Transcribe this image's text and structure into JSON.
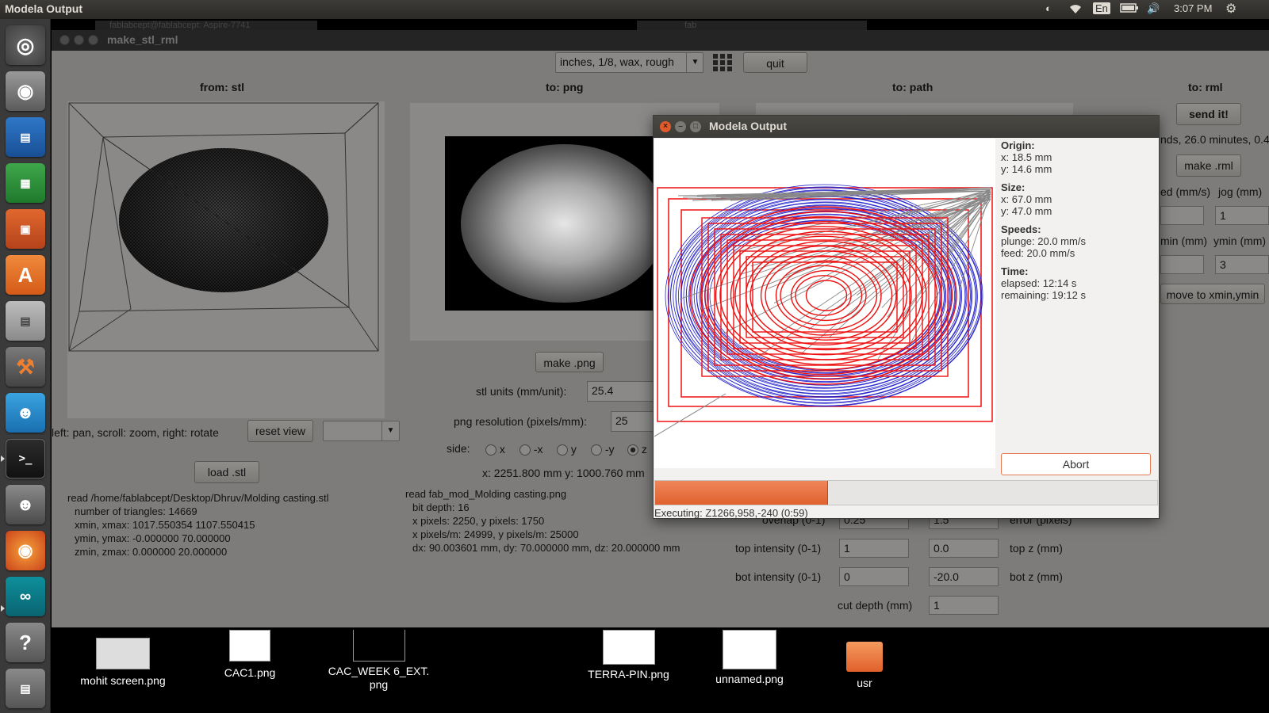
{
  "topbar": {
    "app_title": "Modela Output",
    "keyboard": "En",
    "clock": "3:07 PM"
  },
  "background_windows": {
    "tab1": "fablabcept@fablabcept: Aspire-7741",
    "tab2": "fab"
  },
  "main_window": {
    "title": "make_stl_rml",
    "preset": "inches, 1/8, wax, rough",
    "quit": "quit",
    "col_from_stl": "from: stl",
    "col_to_png": "to: png",
    "col_to_path": "to: path",
    "col_to_rml": "to: rml",
    "hint": "left: pan, scroll: zoom, right: rotate",
    "reset_view": "reset view",
    "view_select": "",
    "load_stl": "load .stl",
    "stl_info": [
      "read /home/fablabcept/Desktop/Dhruv/Molding casting.stl",
      "number of triangles: 14669",
      "xmin, xmax: 1017.550354 1107.550415",
      "ymin, ymax: -0.000000 70.000000",
      "zmin, zmax: 0.000000 20.000000"
    ],
    "make_png": "make .png",
    "stl_units_label": "stl units (mm/unit):",
    "stl_units_value": "25.4",
    "png_res_label": "png resolution (pixels/mm):",
    "png_res_value": "25",
    "side_label": "side:",
    "side_options": [
      "x",
      "-x",
      "y",
      "-y",
      "z"
    ],
    "side_selected": "z",
    "xy_readout": "x: 2251.800 mm  y: 1000.760 mm",
    "png_info": [
      "read fab_mod_Molding casting.png",
      "bit depth: 16",
      "x pixels: 2250, y pixels: 1750",
      "x pixels/m: 24999, y pixels/m: 25000",
      "dx: 90.003601 mm, dy: 70.000000 mm, dz: 20.000000 mm"
    ],
    "overlap_label": "overlap (0-1)",
    "overlap_value": "0.25",
    "error_value": "1.5",
    "error_label": "error (pixels)",
    "top_intensity_label": "top intensity (0-1)",
    "top_intensity_value": "1",
    "top_z_value": "0.0",
    "top_z_label": "top z (mm)",
    "bot_intensity_label": "bot intensity (0-1)",
    "bot_intensity_value": "0",
    "bot_z_value": "-20.0",
    "bot_z_label": "bot z (mm)",
    "cut_depth_label": "cut depth (mm)",
    "cut_depth_value": "1",
    "send_it": "send it!",
    "rml_status": "nds, 26.0 minutes, 0.4",
    "make_rml": "make .rml",
    "speed_label": "ed (mm/s)",
    "jog_label": "jog (mm)",
    "jog_value": "1",
    "xmin_label": "min (mm)",
    "ymin_label": "ymin (mm)",
    "ymin_value": "3",
    "move_to": "move to xmin,ymin"
  },
  "dialog": {
    "title": "Modela Output",
    "origin_h": "Origin:",
    "origin_x": "x: 18.5 mm",
    "origin_y": "y: 14.6 mm",
    "size_h": "Size:",
    "size_x": "x: 67.0 mm",
    "size_y": "y: 47.0 mm",
    "speeds_h": "Speeds:",
    "plunge": "plunge: 20.0 mm/s",
    "feed": "feed: 20.0 mm/s",
    "time_h": "Time:",
    "elapsed": "elapsed: 12:14 s",
    "remaining": "remaining: 19:12 s",
    "abort": "Abort",
    "progress_fraction": 0.345,
    "status": "Executing: Z1266,958,-240 (0:59)"
  },
  "desktop_icons": [
    {
      "label": "mohit screen.png"
    },
    {
      "label": "CAC1.png"
    },
    {
      "label": "CAC_WEEK 6_EXT.\npng"
    },
    {
      "label": "TERRA-PIN.png"
    },
    {
      "label": "unnamed.png"
    },
    {
      "label": "usr"
    }
  ],
  "colors": {
    "accent": "#e0612e",
    "toolpath_red": "#ee1111",
    "toolpath_blue": "#2222cc",
    "toolpath_gray": "#888888"
  }
}
